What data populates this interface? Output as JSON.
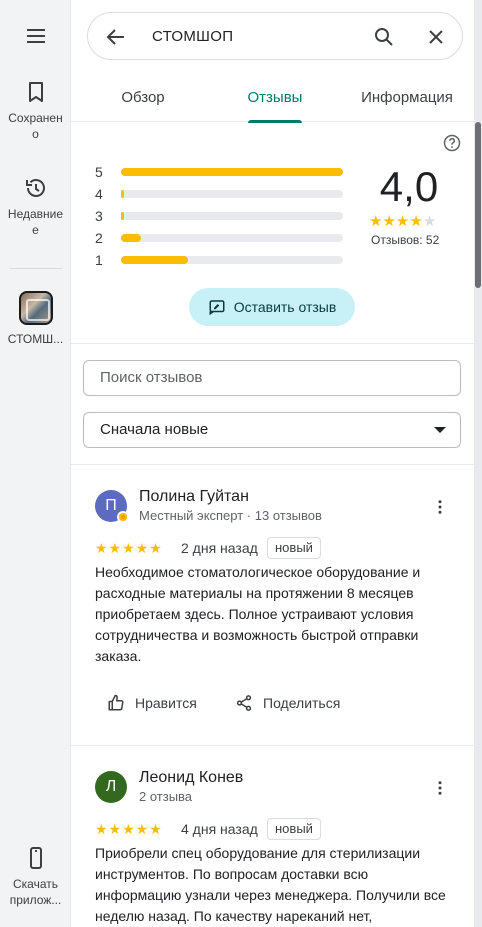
{
  "rail": {
    "menu_icon": "menu-icon",
    "saved_label": "Сохранено",
    "saved_label_l1": "Сохранен",
    "saved_label_l2": "о",
    "recent_label_l1": "Недавние",
    "recent_label_l2": "е",
    "place_label": "СТОМШ...",
    "download_label_l1": "Скачать",
    "download_label_l2": "прилож..."
  },
  "search": {
    "query": "СТОМШОП",
    "icons": [
      "back-arrow-icon",
      "search-icon",
      "close-icon"
    ]
  },
  "tabs": [
    {
      "label": "Обзор",
      "active": false
    },
    {
      "label": "Отзывы",
      "active": true
    },
    {
      "label": "Информация",
      "active": false
    }
  ],
  "summary": {
    "rating": "4,0",
    "stars_filled": 4,
    "stars_total": 5,
    "count_label": "Отзывов: 52",
    "histogram": [
      {
        "stars": "5",
        "fraction": 1.0
      },
      {
        "stars": "4",
        "fraction": 0.01
      },
      {
        "stars": "3",
        "fraction": 0.01
      },
      {
        "stars": "2",
        "fraction": 0.09
      },
      {
        "stars": "1",
        "fraction": 0.3
      }
    ],
    "write_review_label": "Оставить отзыв"
  },
  "filters": {
    "search_placeholder": "Поиск отзывов",
    "sort_value": "Сначала новые"
  },
  "reviews": [
    {
      "name": "Полина Гуйтан",
      "meta": "Местный эксперт · 13 отзывов",
      "initial": "П",
      "avatar_color": "#5c6bc0",
      "local_guide": true,
      "stars": "★★★★★",
      "date": "2 дня назад",
      "badge": "новый",
      "text": "Необходимое стоматологическое оборудование и расходные материалы на протяжении 8 месяцев приобретаем здесь. Полное устраивают условия сотрудничества и возможность быстрой отправки заказа.",
      "like_label": "Нравится",
      "share_label": "Поделиться"
    },
    {
      "name": "Леонид Конев",
      "meta": "2 отзыва",
      "initial": "Л",
      "avatar_color": "#33691e",
      "local_guide": false,
      "stars": "★★★★★",
      "date": "4 дня назад",
      "badge": "новый",
      "text": "Приобрели спец оборудование для стерилизации инструментов. По вопросам доставки всю информацию узнали через менеджера. Получили все неделю назад. По качеству нареканий нет,"
    }
  ],
  "colors": {
    "accent": "#00796b",
    "star": "#fbbc04",
    "button_bg": "#c7f0f7"
  }
}
